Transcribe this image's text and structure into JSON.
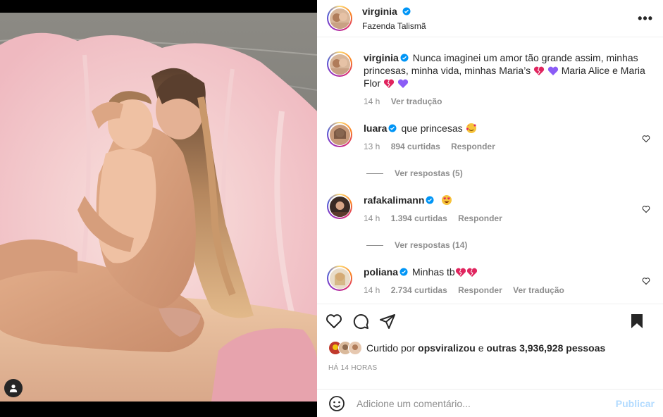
{
  "post": {
    "username": "virginia",
    "location": "Fazenda Talismã",
    "more_label": "•••"
  },
  "caption": {
    "username": "virginia",
    "text_part1": "Nunca imaginei um amor tão grande assim, minhas princesas, minha vida, minhas Maria’s",
    "text_part2": "Maria Alice e Maria Flor",
    "time": "14 h",
    "translate": "Ver tradução"
  },
  "comments": [
    {
      "username": "luara",
      "text": "que princesas",
      "time": "13 h",
      "likes": "894 curtidas",
      "reply": "Responder",
      "view_replies": "Ver respostas (5)"
    },
    {
      "username": "rafakalimann",
      "text": "",
      "time": "14 h",
      "likes": "1.394 curtidas",
      "reply": "Responder",
      "view_replies": "Ver respostas (14)"
    },
    {
      "username": "poliana",
      "text": "Minhas tb",
      "time": "14 h",
      "likes": "2.734 curtidas",
      "reply": "Responder",
      "translate": "Ver tradução"
    }
  ],
  "likes": {
    "prefix": "Curtido por",
    "user": "opsviralizou",
    "middle": "e",
    "others": "outras 3,936,928 pessoas"
  },
  "timestamp": "HÁ 14 HORAS",
  "add_comment": {
    "placeholder": "Adicione um comentário...",
    "publish": "Publicar"
  },
  "colors": {
    "verified": "#0095f6",
    "publish_disabled": "#b3dbff",
    "muted": "#8e8e8e",
    "text": "#262626"
  },
  "icons": [
    "verified-icon",
    "heart-icon",
    "comment-icon",
    "share-icon",
    "bookmark-icon",
    "emoji-icon",
    "user-tag-icon",
    "more-icon"
  ]
}
